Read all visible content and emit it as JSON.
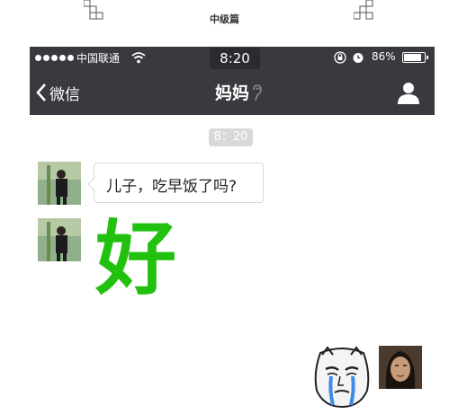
{
  "banner": {
    "title": "中级篇"
  },
  "status_bar": {
    "carrier": "中国联通",
    "time": "8:20",
    "battery": "86%",
    "battery_level": 0.86,
    "icons": [
      "signal-dots",
      "wifi-icon",
      "rotation-lock-icon",
      "alarm-icon",
      "battery-icon"
    ]
  },
  "nav": {
    "back_label": "微信",
    "title": "妈妈",
    "icons": [
      "chevron-left-icon",
      "ear-icon",
      "person-icon"
    ]
  },
  "chat": {
    "timestamp": "8：20",
    "messages": [
      {
        "sender": "other",
        "type": "text",
        "text": "儿子，吃早饭了吗?"
      },
      {
        "sender": "other",
        "type": "big-text",
        "text": "好",
        "color": "#22c10f"
      },
      {
        "sender": "self",
        "type": "sticker",
        "sticker": "crying-meme-face"
      }
    ]
  },
  "colors": {
    "bar_bg": "#393a3f",
    "accent_green": "#22c10f",
    "timestamp_bg": "#d9d9d9"
  }
}
